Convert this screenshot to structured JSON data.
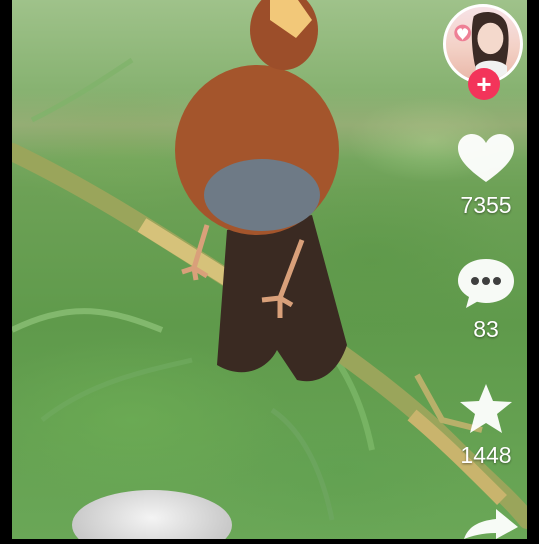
{
  "actions": {
    "likes": "7355",
    "comments": "83",
    "favorites": "1448"
  },
  "follow_button": {
    "symbol": "+"
  },
  "icons": {
    "like": "heart-icon",
    "comment": "comment-bubble-icon",
    "favorite": "star-icon",
    "share": "share-arrow-icon",
    "follow": "plus-icon"
  },
  "colors": {
    "follow_accent": "#f3345a",
    "icon_fill": "#ffffff"
  }
}
